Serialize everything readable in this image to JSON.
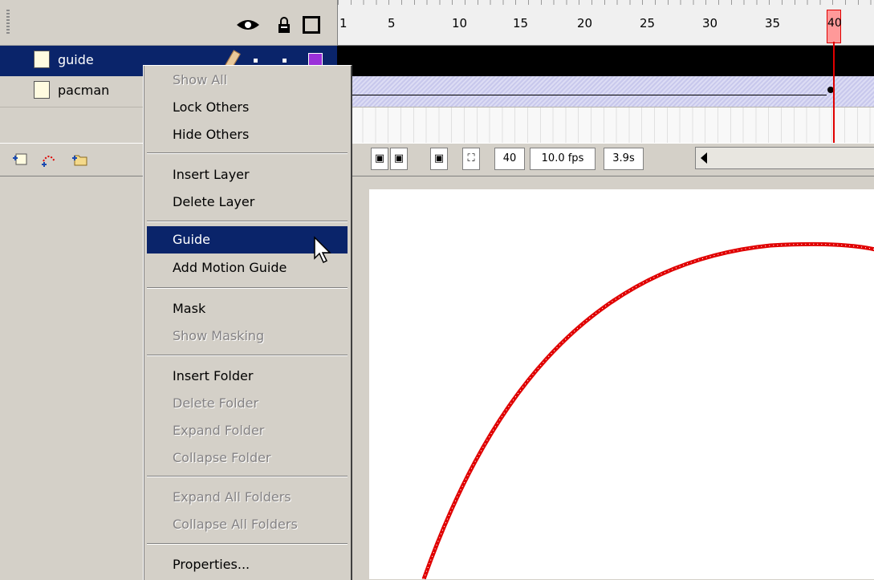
{
  "layers": [
    {
      "name": "guide",
      "selected": true
    },
    {
      "name": "pacman",
      "selected": false
    }
  ],
  "ruler": {
    "labels": [
      "1",
      "5",
      "10",
      "15",
      "20",
      "25",
      "30",
      "35",
      "40"
    ]
  },
  "timeline_status": {
    "current_frame": "40",
    "frame_rate": "10.0 fps",
    "elapsed_time": "3.9s"
  },
  "context_menu": {
    "show_all": "Show All",
    "lock_others": "Lock Others",
    "hide_others": "Hide Others",
    "insert_layer": "Insert Layer",
    "delete_layer": "Delete Layer",
    "guide": "Guide",
    "add_motion_guide": "Add Motion Guide",
    "mask": "Mask",
    "show_masking": "Show Masking",
    "insert_folder": "Insert Folder",
    "delete_folder": "Delete Folder",
    "expand_folder": "Expand Folder",
    "collapse_folder": "Collapse Folder",
    "expand_all_folders": "Expand All Folders",
    "collapse_all_folders": "Collapse All Folders",
    "properties": "Properties..."
  },
  "colors": {
    "selection": "#0a246a",
    "layer_outline_swatch": "#9b30d9",
    "playhead": "#e00000",
    "guide_path": "#e00000"
  }
}
